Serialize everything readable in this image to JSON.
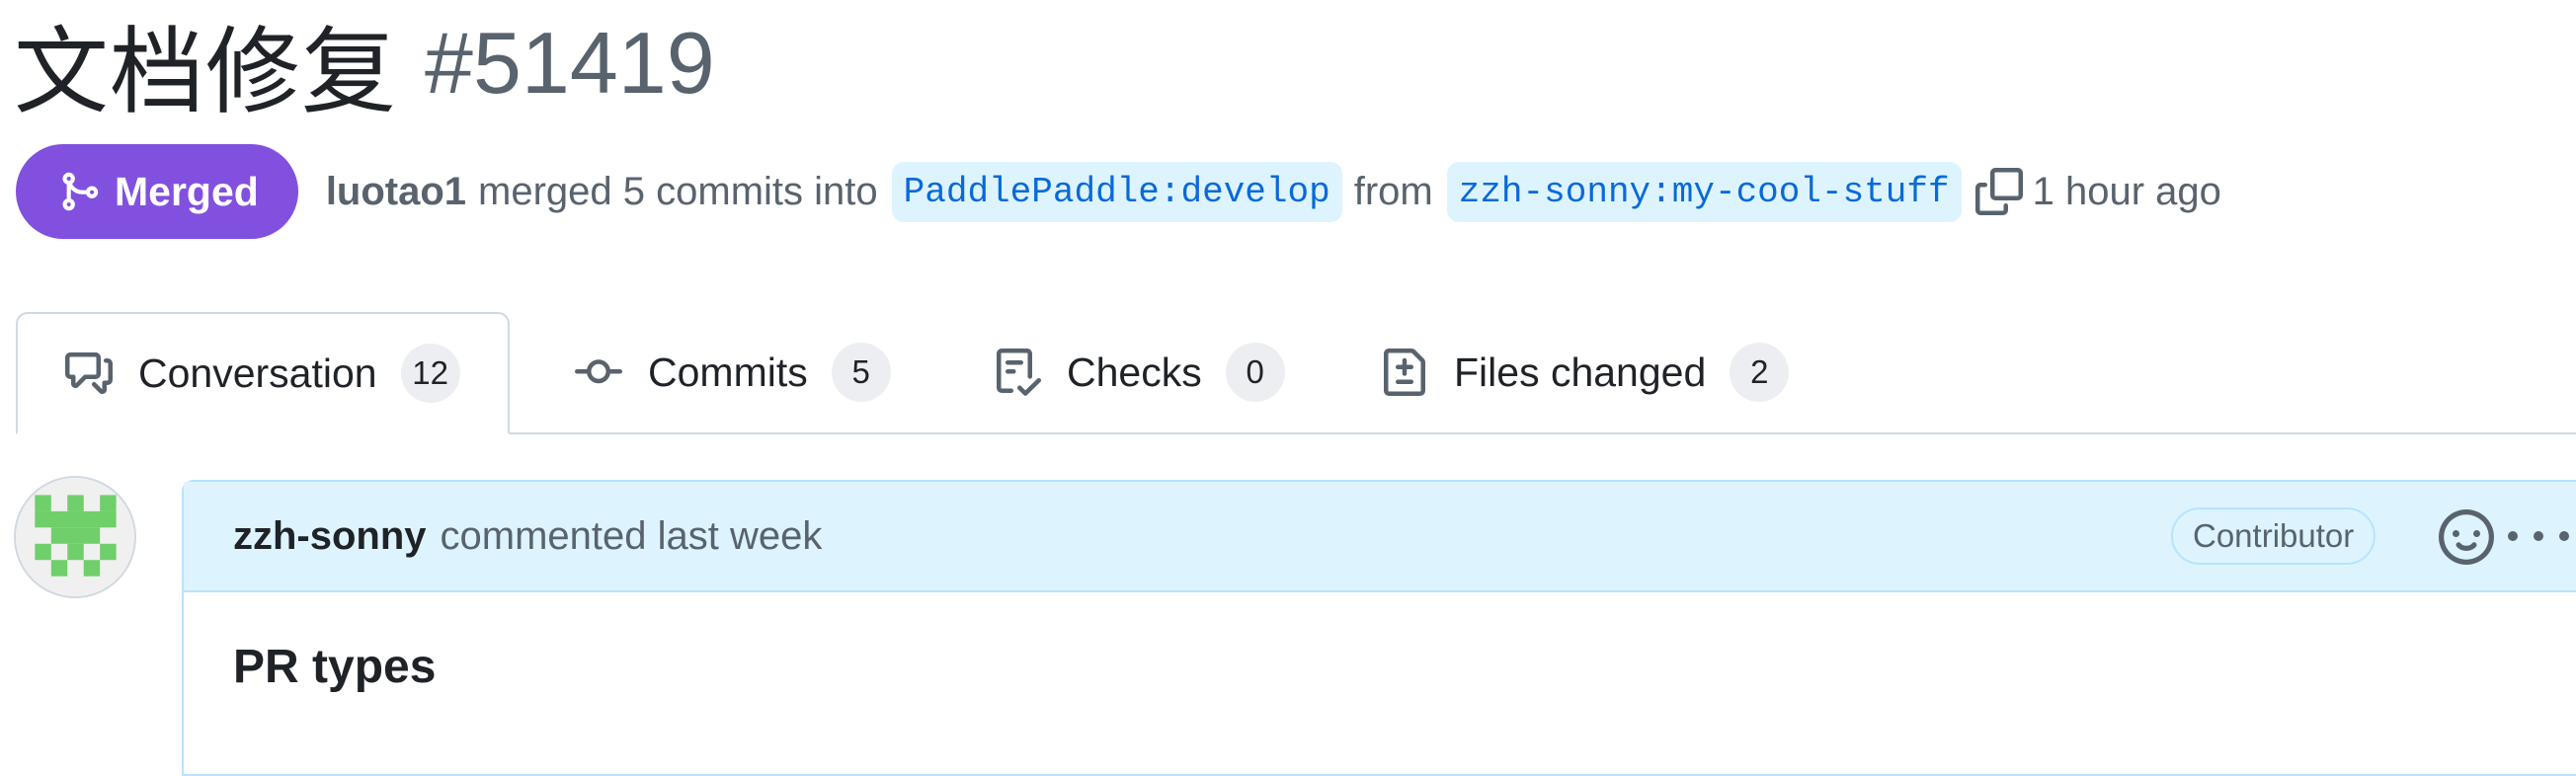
{
  "pr": {
    "title": "文档修复",
    "number": "#51419",
    "state_label": "Merged",
    "author": "luotao1",
    "merge_text_1": "merged 5 commits into",
    "base_branch": "PaddlePaddle:develop",
    "merge_text_2": "from",
    "head_branch": "zzh-sonny:my-cool-stuff",
    "time": "1 hour ago"
  },
  "tabs": [
    {
      "label": "Conversation",
      "count": "12",
      "icon": "comment-discussion-icon"
    },
    {
      "label": "Commits",
      "count": "5",
      "icon": "git-commit-icon"
    },
    {
      "label": "Checks",
      "count": "0",
      "icon": "checklist-icon"
    },
    {
      "label": "Files changed",
      "count": "2",
      "icon": "file-diff-icon"
    }
  ],
  "comment": {
    "author": "zzh-sonny",
    "action": "commented last week",
    "role_badge": "Contributor",
    "body_heading": "PR types"
  },
  "colors": {
    "merged": "#8250df",
    "link": "#0969da",
    "branch_bg": "#ddf4ff",
    "comment_header_bg": "#ddf4ff",
    "avatar_green": "#6fcf6a"
  }
}
